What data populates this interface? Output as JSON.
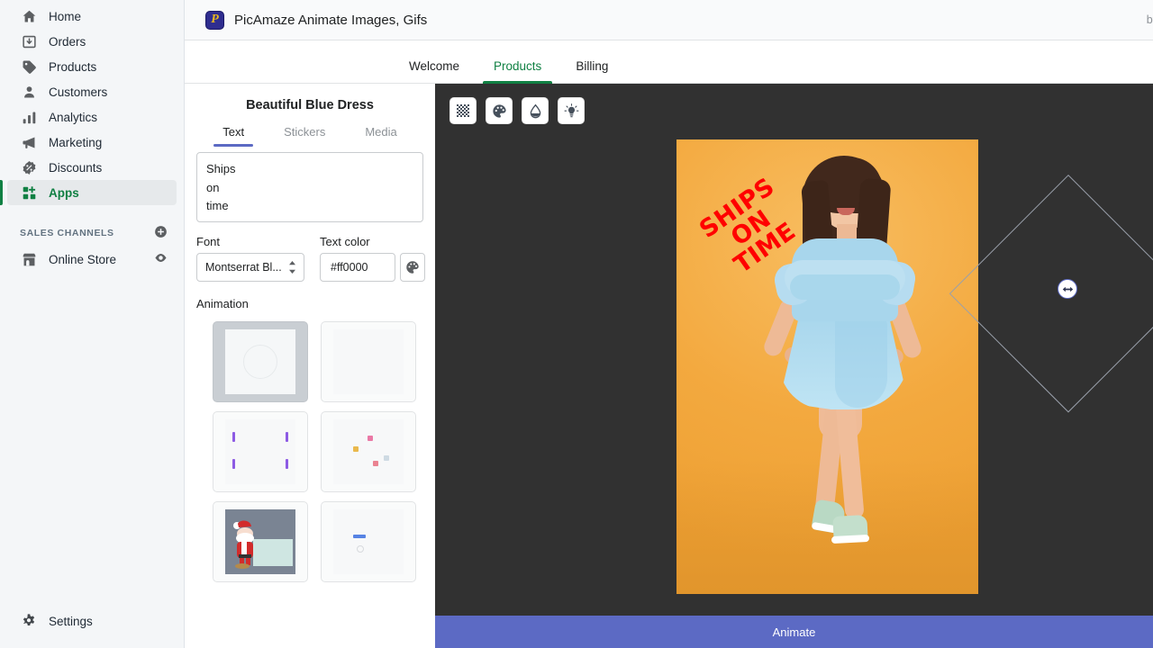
{
  "sidebar": {
    "items": [
      {
        "label": "Home",
        "icon": "home-icon"
      },
      {
        "label": "Orders",
        "icon": "orders-icon"
      },
      {
        "label": "Products",
        "icon": "products-tag-icon"
      },
      {
        "label": "Customers",
        "icon": "customers-person-icon"
      },
      {
        "label": "Analytics",
        "icon": "analytics-bars-icon"
      },
      {
        "label": "Marketing",
        "icon": "marketing-megaphone-icon"
      },
      {
        "label": "Discounts",
        "icon": "discounts-badge-icon"
      },
      {
        "label": "Apps",
        "icon": "apps-grid-icon",
        "active": true
      }
    ],
    "sales_channels_label": "SALES CHANNELS",
    "channels": [
      {
        "label": "Online Store",
        "icon": "store-icon"
      }
    ],
    "settings_label": "Settings",
    "active_color": "#108043"
  },
  "header": {
    "app_title": "PicAmaze Animate Images, Gifs",
    "logo_letter": "P",
    "by_label": "by"
  },
  "tabs": [
    {
      "label": "Welcome",
      "active": false
    },
    {
      "label": "Products",
      "active": true
    },
    {
      "label": "Billing",
      "active": false
    }
  ],
  "panel": {
    "title": "Beautiful Blue Dress",
    "tabs": [
      {
        "label": "Text",
        "active": true
      },
      {
        "label": "Stickers",
        "active": false
      },
      {
        "label": "Media",
        "active": false
      }
    ],
    "text_value": "Ships\non\ntime",
    "font_label": "Font",
    "font_value": "Montserrat Bl...",
    "color_label": "Text color",
    "color_value": "#ff0000",
    "color_picker_icon": "palette-icon",
    "animation_label": "Animation",
    "animations": [
      {
        "name": "animation-preset-1",
        "selected": true
      },
      {
        "name": "animation-preset-2",
        "selected": false
      },
      {
        "name": "animation-preset-3",
        "selected": false
      },
      {
        "name": "animation-preset-4",
        "selected": false
      },
      {
        "name": "animation-preset-santa",
        "selected": false
      },
      {
        "name": "animation-preset-6",
        "selected": false
      }
    ]
  },
  "canvas": {
    "tools": [
      {
        "name": "transparency-checker-icon"
      },
      {
        "name": "palette-icon"
      },
      {
        "name": "fill-droplet-icon"
      },
      {
        "name": "brightness-bulb-icon"
      }
    ],
    "overlay_text_lines": [
      "SHIPS",
      "ON",
      "TIME"
    ],
    "overlay_text_color": "#ff0000",
    "background_color": "#313131",
    "image_background_color": "#f3a93f",
    "handles": [
      {
        "name": "rotate-handle-top",
        "icon": "rotate-icon"
      },
      {
        "name": "resize-handle-left",
        "icon": "double-arrow-icon"
      },
      {
        "name": "resize-handle-right",
        "icon": "double-arrow-icon"
      },
      {
        "name": "rotate-handle-bottom",
        "icon": "rotate-icon"
      }
    ],
    "animate_button_label": "Animate",
    "animate_button_color": "#5c6ac4"
  }
}
